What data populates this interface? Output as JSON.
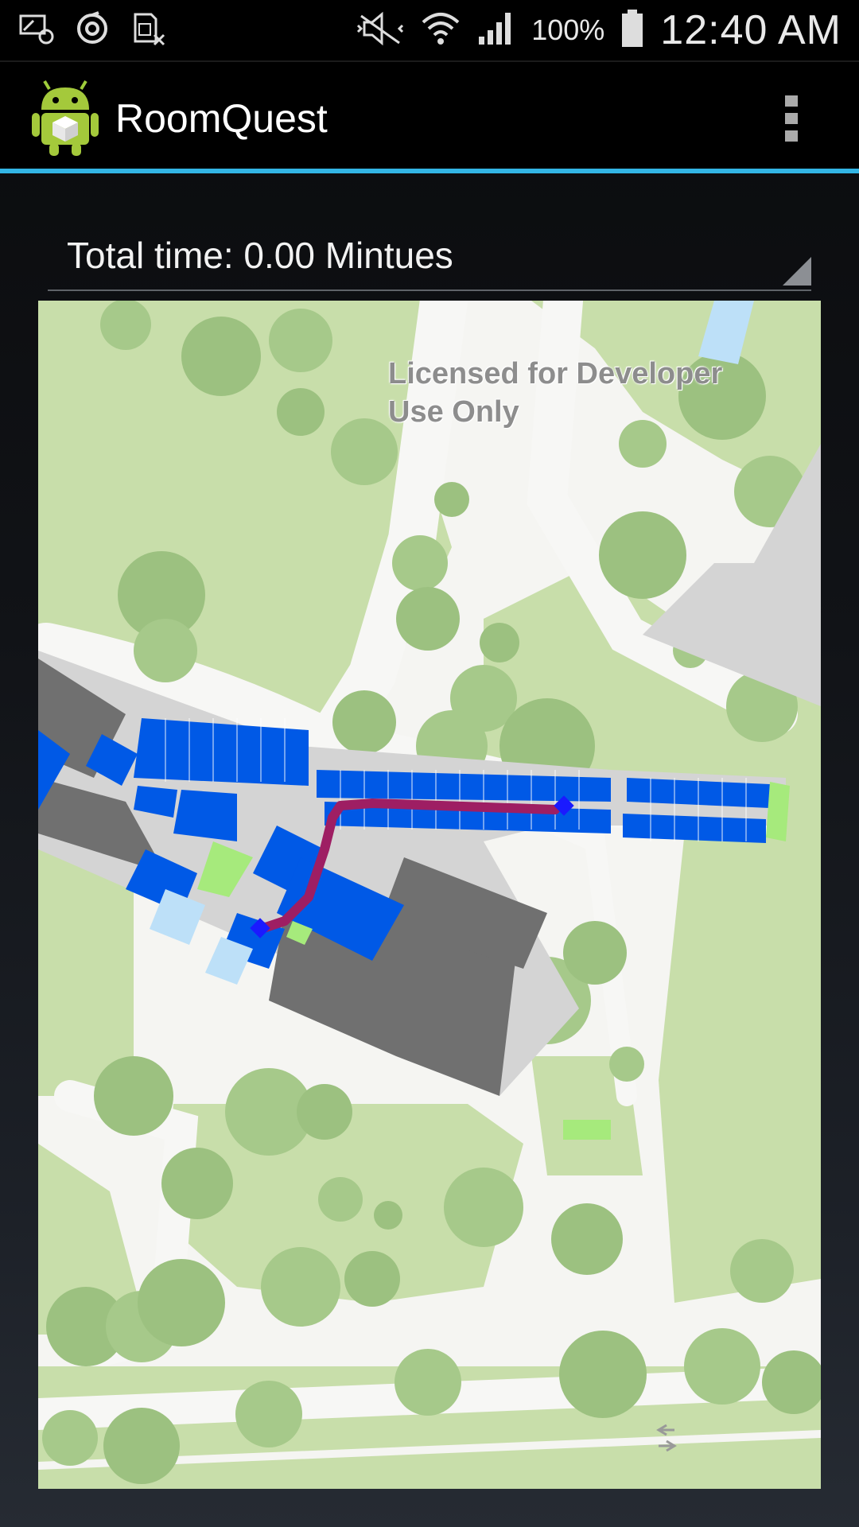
{
  "status_bar": {
    "icons_left": [
      "screen-mirroring-icon",
      "sync-icon",
      "no-sim-icon"
    ],
    "icons_right": [
      "mute-icon",
      "wifi-icon",
      "cell-signal-icon",
      "battery-icon"
    ],
    "battery_percent": "100%",
    "time": "12:40 AM"
  },
  "app_bar": {
    "title": "RoomQuest",
    "menu_icon": "overflow-menu-icon"
  },
  "route_spinner": {
    "selected": "Total time: 0.00 Mintues"
  },
  "map": {
    "watermark_line1": "Licensed for Developer",
    "watermark_line2": "Use Only",
    "colors": {
      "grass": "#c8deaa",
      "path": "#f7f7f5",
      "rooms": "#0059e6",
      "corridor": "#d4d4d4",
      "dark_rooms": "#707070",
      "route": "#9e1e63",
      "stop_marker": "#1a1aff",
      "green_room": "#a6ea7c",
      "light_blue_room": "#bde0f8"
    }
  }
}
